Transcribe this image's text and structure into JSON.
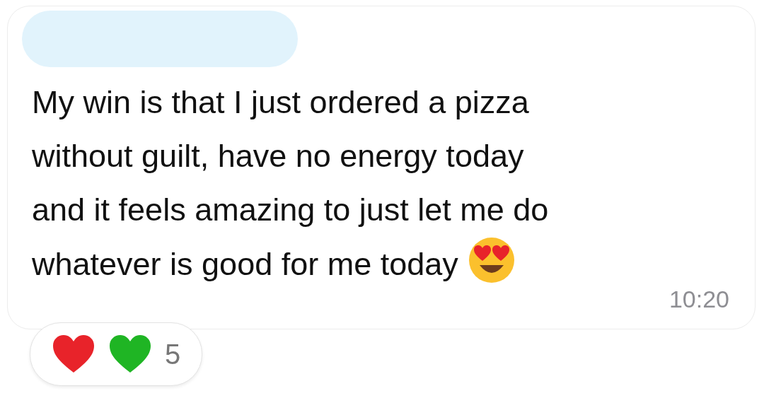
{
  "message": {
    "lines": [
      "My win is that I just ordered a pizza",
      "without guilt, have no energy today",
      "and it feels amazing to just let me do",
      "whatever is good for me today"
    ],
    "time": "10:20"
  },
  "reactions": {
    "hearts": [
      {
        "color": "#e8232a"
      },
      {
        "color": "#1fb524"
      }
    ],
    "count": "5"
  }
}
